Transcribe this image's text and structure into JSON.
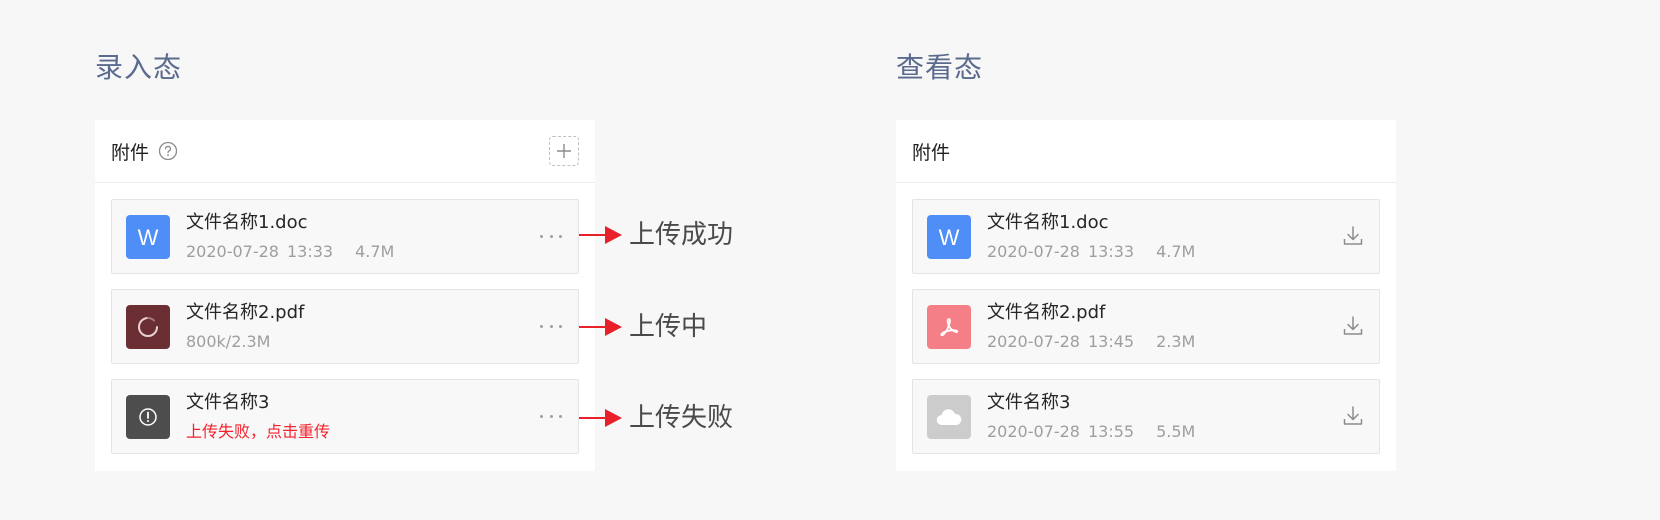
{
  "sections": {
    "input_title": "录入态",
    "view_title": "查看态"
  },
  "left_panel": {
    "header_label": "附件",
    "files": [
      {
        "name": "文件名称1.doc",
        "date": "2020-07-28",
        "time": "13:33",
        "size": "4.7M",
        "icon": "word-icon",
        "icon_color": "#4f8ef7"
      },
      {
        "name": "文件名称2.pdf",
        "progress": "800k/2.3M",
        "icon": "loading-spinner-icon",
        "icon_color": "#6b2f33"
      },
      {
        "name": "文件名称3",
        "error": "上传失败，点击重传",
        "icon": "alert-icon",
        "icon_color": "#4d4d4d"
      }
    ]
  },
  "right_panel": {
    "header_label": "附件",
    "files": [
      {
        "name": "文件名称1.doc",
        "date": "2020-07-28",
        "time": "13:33",
        "size": "4.7M",
        "icon": "word-icon",
        "icon_color": "#4f8ef7"
      },
      {
        "name": "文件名称2.pdf",
        "date": "2020-07-28",
        "time": "13:45",
        "size": "2.3M",
        "icon": "pdf-icon",
        "icon_color": "#f57f87"
      },
      {
        "name": "文件名称3",
        "date": "2020-07-28",
        "time": "13:55",
        "size": "5.5M",
        "icon": "cloud-icon",
        "icon_color": "#cccccc"
      }
    ]
  },
  "states": {
    "success": "上传成功",
    "uploading": "上传中",
    "failed": "上传失败"
  },
  "colors": {
    "arrow": "#e8202a",
    "error_text": "#f5222d",
    "section_title": "#5b6b8f"
  }
}
